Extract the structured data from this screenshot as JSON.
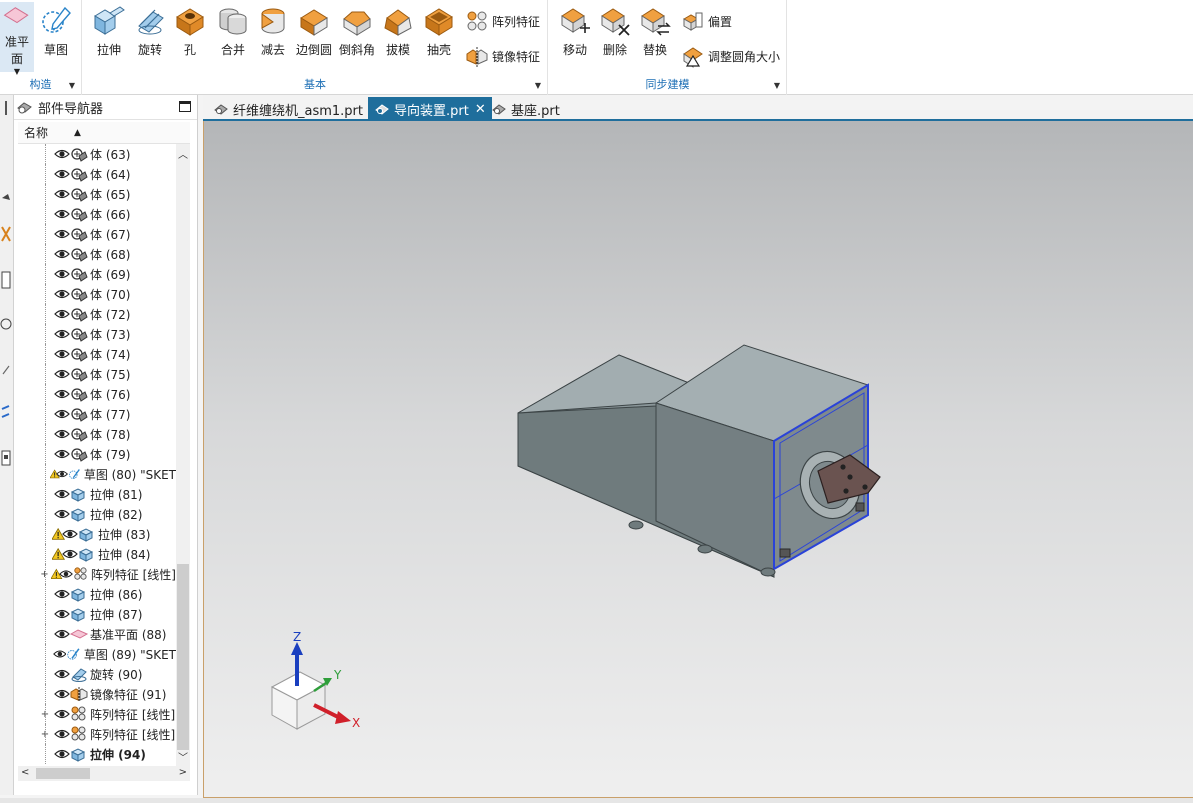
{
  "ribbon": {
    "groups": [
      {
        "label": "构造",
        "buttons": [
          {
            "label": "准平面"
          },
          {
            "label": "草图"
          }
        ]
      },
      {
        "label": "基本",
        "buttons": [
          {
            "label": "拉伸"
          },
          {
            "label": "旋转"
          },
          {
            "label": "孔"
          },
          {
            "label": "合并"
          },
          {
            "label": "减去"
          },
          {
            "label": "边倒圆"
          },
          {
            "label": "倒斜角"
          },
          {
            "label": "拔模"
          },
          {
            "label": "抽壳"
          }
        ],
        "small_buttons": [
          {
            "label": "阵列特征"
          },
          {
            "label": "镜像特征"
          }
        ]
      },
      {
        "label": "同步建模",
        "buttons": [
          {
            "label": "移动"
          },
          {
            "label": "删除"
          },
          {
            "label": "替换"
          }
        ],
        "small_buttons": [
          {
            "label": "偏置"
          },
          {
            "label": "调整圆角大小"
          }
        ]
      }
    ]
  },
  "navigator": {
    "title": "部件导航器",
    "column_header": "名称",
    "rows": [
      {
        "label": "体 (63)",
        "icon": "body-icon",
        "warn": false,
        "expander": false,
        "bold": false
      },
      {
        "label": "体 (64)",
        "icon": "body-icon",
        "warn": false,
        "expander": false,
        "bold": false
      },
      {
        "label": "体 (65)",
        "icon": "body-icon",
        "warn": false,
        "expander": false,
        "bold": false
      },
      {
        "label": "体 (66)",
        "icon": "body-icon",
        "warn": false,
        "expander": false,
        "bold": false
      },
      {
        "label": "体 (67)",
        "icon": "body-icon",
        "warn": false,
        "expander": false,
        "bold": false
      },
      {
        "label": "体 (68)",
        "icon": "body-icon",
        "warn": false,
        "expander": false,
        "bold": false
      },
      {
        "label": "体 (69)",
        "icon": "body-icon",
        "warn": false,
        "expander": false,
        "bold": false
      },
      {
        "label": "体 (70)",
        "icon": "body-icon",
        "warn": false,
        "expander": false,
        "bold": false
      },
      {
        "label": "体 (72)",
        "icon": "body-icon",
        "warn": false,
        "expander": false,
        "bold": false
      },
      {
        "label": "体 (73)",
        "icon": "body-icon",
        "warn": false,
        "expander": false,
        "bold": false
      },
      {
        "label": "体 (74)",
        "icon": "body-icon",
        "warn": false,
        "expander": false,
        "bold": false
      },
      {
        "label": "体 (75)",
        "icon": "body-icon",
        "warn": false,
        "expander": false,
        "bold": false
      },
      {
        "label": "体 (76)",
        "icon": "body-icon",
        "warn": false,
        "expander": false,
        "bold": false
      },
      {
        "label": "体 (77)",
        "icon": "body-icon",
        "warn": false,
        "expander": false,
        "bold": false
      },
      {
        "label": "体 (78)",
        "icon": "body-icon",
        "warn": false,
        "expander": false,
        "bold": false
      },
      {
        "label": "体 (79)",
        "icon": "body-icon",
        "warn": false,
        "expander": false,
        "bold": false
      },
      {
        "label": "草图 (80) \"SKET",
        "icon": "sketch-icon",
        "warn": true,
        "expander": false,
        "bold": false
      },
      {
        "label": "拉伸 (81)",
        "icon": "extrude-icon",
        "warn": false,
        "expander": false,
        "bold": false
      },
      {
        "label": "拉伸 (82)",
        "icon": "extrude-icon",
        "warn": false,
        "expander": false,
        "bold": false
      },
      {
        "label": "拉伸 (83)",
        "icon": "extrude-icon",
        "warn": true,
        "expander": false,
        "bold": false
      },
      {
        "label": "拉伸 (84)",
        "icon": "extrude-icon",
        "warn": true,
        "expander": false,
        "bold": false
      },
      {
        "label": "阵列特征 [线性]",
        "icon": "pattern-icon",
        "warn": true,
        "expander": true,
        "bold": false
      },
      {
        "label": "拉伸 (86)",
        "icon": "extrude-icon",
        "warn": false,
        "expander": false,
        "bold": false
      },
      {
        "label": "拉伸 (87)",
        "icon": "extrude-icon",
        "warn": false,
        "expander": false,
        "bold": false
      },
      {
        "label": "基准平面 (88)",
        "icon": "datum-plane-icon",
        "warn": false,
        "expander": false,
        "bold": false
      },
      {
        "label": "草图 (89) \"SKET",
        "icon": "sketch-icon",
        "warn": false,
        "expander": false,
        "bold": false
      },
      {
        "label": "旋转 (90)",
        "icon": "revolve-icon",
        "warn": false,
        "expander": false,
        "bold": false
      },
      {
        "label": "镜像特征 (91)",
        "icon": "mirror-icon",
        "warn": false,
        "expander": false,
        "bold": false
      },
      {
        "label": "阵列特征 [线性]",
        "icon": "pattern-icon",
        "warn": false,
        "expander": true,
        "bold": false
      },
      {
        "label": "阵列特征 [线性]",
        "icon": "pattern-icon",
        "warn": false,
        "expander": true,
        "bold": false
      },
      {
        "label": "拉伸 (94)",
        "icon": "extrude-icon",
        "warn": false,
        "expander": false,
        "bold": true
      }
    ]
  },
  "tabs": [
    {
      "label": "纤维缠绕机_asm1.prt",
      "active": false
    },
    {
      "label": "导向装置.prt",
      "active": true
    },
    {
      "label": "基座.prt",
      "active": false
    }
  ],
  "viewport": {
    "triad": {
      "x": "X",
      "y": "Y",
      "z": "Z"
    },
    "colors": {
      "x": "#d0202a",
      "y": "#2e9e3a",
      "z": "#1a3fbf",
      "model": "#8e9a9c",
      "highlight": "#2a43d8"
    }
  }
}
